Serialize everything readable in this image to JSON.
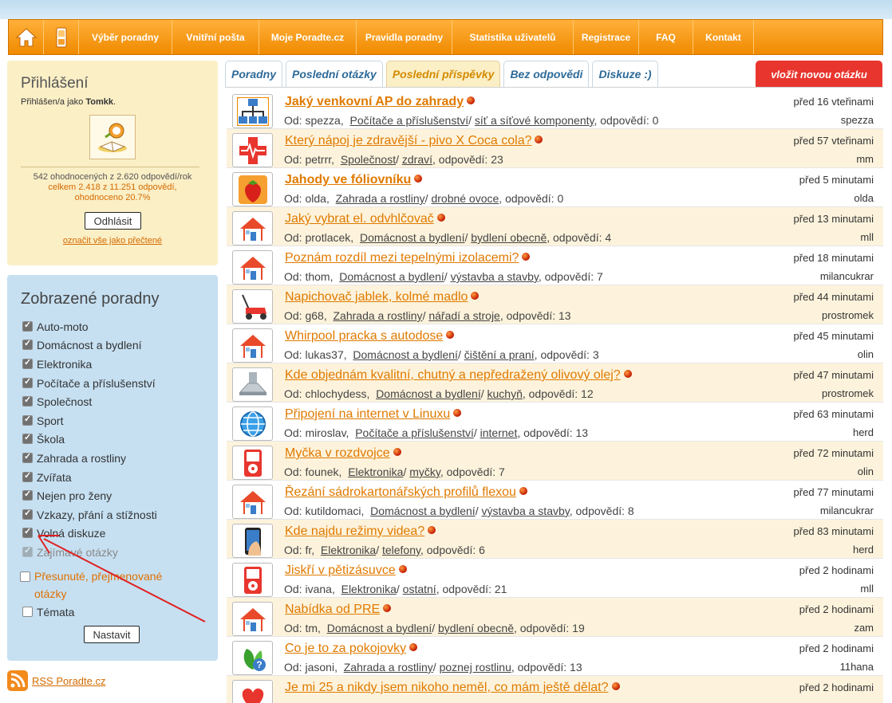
{
  "nav": {
    "items": [
      "Výběr poradny",
      "Vnitřní pošta",
      "Moje Poradte.cz",
      "Pravidla poradny",
      "Statistika uživatelů",
      "Registrace",
      "FAQ",
      "Kontakt"
    ]
  },
  "login": {
    "title": "Přihlášení",
    "logged_as_prefix": "Přihlášen/a jako ",
    "username": "Tomkk",
    "username_suffix": ".",
    "stats_line1": "542 ohodnocených z 2.620 odpovědí/rok",
    "stats_line2": "celkem 2.418 z 11.251 odpovědí,",
    "stats_line3": "ohodnoceno 20.7%",
    "logout_label": "Odhlásit",
    "mark_read_label": "označit vše jako přečtené"
  },
  "categories": {
    "title": "Zobrazené poradny",
    "items": [
      {
        "label": "Auto-moto",
        "checked": true
      },
      {
        "label": "Domácnost a bydlení",
        "checked": true
      },
      {
        "label": "Elektronika",
        "checked": true
      },
      {
        "label": "Počítače a příslušenství",
        "checked": true
      },
      {
        "label": "Společnost",
        "checked": true
      },
      {
        "label": "Sport",
        "checked": true
      },
      {
        "label": "Škola",
        "checked": true
      },
      {
        "label": "Zahrada a rostliny",
        "checked": true
      },
      {
        "label": "Zvířata",
        "checked": true
      },
      {
        "label": "Nejen pro ženy",
        "checked": true
      },
      {
        "label": "Vzkazy, přání a stížnosti",
        "checked": true
      },
      {
        "label": "Volná diskuze",
        "checked": true
      },
      {
        "label": "Zajímavé otázky",
        "checked": true,
        "disabled": true
      },
      {
        "label": "Přesunuté, přejmenované otázky",
        "checked": false,
        "orange": true
      },
      {
        "label": "Témata",
        "checked": false
      }
    ],
    "set_label": "Nastavit"
  },
  "rss": {
    "label": "RSS Poradte.cz"
  },
  "tabs": [
    {
      "label": "Poradny",
      "active": false
    },
    {
      "label": "Poslední otázky",
      "active": false
    },
    {
      "label": "Poslední příspěvky",
      "active": true
    },
    {
      "label": "Bez odpovědi",
      "active": false
    },
    {
      "label": "Diskuze :)",
      "active": false
    }
  ],
  "new_question_label": "vložit novou otázku",
  "questions": [
    {
      "title": "Jaký venkovní AP do zahrady",
      "bold": true,
      "author": "spezza",
      "cat": "Počítače a příslušenství",
      "sub": "síť a síťové komponenty",
      "answers": "0",
      "time": "před 16 vteřinami",
      "user": "spezza",
      "icon": "network-icon"
    },
    {
      "title": "Který nápoj je zdravější - pivo X Coca cola?",
      "bold": false,
      "author": "petrrr",
      "cat": "Společnost",
      "sub": "zdraví",
      "answers": "23",
      "time": "před 57 vteřinami",
      "user": "mm",
      "icon": "health-icon"
    },
    {
      "title": "Jahody ve fóliovníku",
      "bold": true,
      "author": "olda",
      "cat": "Zahrada a rostliny",
      "sub": "drobné ovoce",
      "answers": "0",
      "time": "před 5 minutami",
      "user": "olda",
      "icon": "strawberry-icon"
    },
    {
      "title": "Jaký vybrat el. odvhlčovač",
      "bold": false,
      "author": "protlacek",
      "cat": "Domácnost a bydlení",
      "sub": "bydlení obecně",
      "answers": "4",
      "time": "před 13 minutami",
      "user": "mll",
      "icon": "house-icon"
    },
    {
      "title": "Poznám rozdíl mezi tepelnými izolacemi?",
      "bold": false,
      "author": "thom",
      "cat": "Domácnost a bydlení",
      "sub": "výstavba a stavby",
      "answers": "7",
      "time": "před 18 minutami",
      "user": "milancukrar",
      "icon": "house-icon"
    },
    {
      "title": "Napichovač jablek, kolmé madlo",
      "bold": false,
      "author": "g68",
      "cat": "Zahrada a rostliny",
      "sub": "nářadí a stroje",
      "answers": "13",
      "time": "před 44 minutami",
      "user": "prostromek",
      "icon": "lawnmower-icon"
    },
    {
      "title": "Whirpool pracka s autodose",
      "bold": false,
      "author": "lukas37",
      "cat": "Domácnost a bydlení",
      "sub": "čištění a praní",
      "answers": "3",
      "time": "před 45 minutami",
      "user": "olin",
      "icon": "house-icon"
    },
    {
      "title": "Kde objednám kvalitní, chutný a nepředražený olivový olej?",
      "bold": false,
      "author": "chlochydess",
      "cat": "Domácnost a bydlení",
      "sub": "kuchyň",
      "answers": "12",
      "time": "před 47 minutami",
      "user": "prostromek",
      "icon": "kitchen-hood-icon"
    },
    {
      "title": "Připojení na internet v Linuxu",
      "bold": false,
      "author": "miroslav",
      "cat": "Počítače a příslušenství",
      "sub": "internet",
      "answers": "13",
      "time": "před 63 minutami",
      "user": "herd",
      "icon": "globe-icon"
    },
    {
      "title": "Myčka v rozdvojce",
      "bold": false,
      "author": "founek",
      "cat": "Elektronika",
      "sub": "myčky",
      "answers": "7",
      "time": "před 72 minutami",
      "user": "olin",
      "icon": "media-player-icon"
    },
    {
      "title": "Řezání sádrokartonářských profilů flexou",
      "bold": false,
      "author": "kutildomaci",
      "cat": "Domácnost a bydlení",
      "sub": "výstavba a stavby",
      "answers": "8",
      "time": "před 77 minutami",
      "user": "milancukrar",
      "icon": "house-icon"
    },
    {
      "title": "Kde najdu režimy videa?",
      "bold": false,
      "author": "fr",
      "cat": "Elektronika",
      "sub": "telefony",
      "answers": "6",
      "time": "před 83 minutami",
      "user": "herd",
      "icon": "phone-icon"
    },
    {
      "title": "Jiskří v pětizásuvce",
      "bold": false,
      "author": "ivana",
      "cat": "Elektronika",
      "sub": "ostatní",
      "answers": "21",
      "time": "před 2 hodinami",
      "user": "mll",
      "icon": "media-player-icon"
    },
    {
      "title": "Nabídka od PRE",
      "bold": false,
      "author": "tm",
      "cat": "Domácnost a bydlení",
      "sub": "bydlení obecně",
      "answers": "19",
      "time": "před 2 hodinami",
      "user": "zam",
      "icon": "house-icon"
    },
    {
      "title": "Co je to za pokojovky",
      "bold": false,
      "author": "jasoni",
      "cat": "Zahrada a rostliny",
      "sub": "poznej rostlinu",
      "answers": "13",
      "time": "před 2 hodinami",
      "user": "11hana",
      "icon": "plant-question-icon"
    },
    {
      "title": "Je mi 25 a nikdy jsem nikoho neměl, co mám ještě dělat?",
      "bold": false,
      "author": "",
      "cat": "",
      "sub": "",
      "answers": "",
      "time": "před 2 hodinami",
      "user": "",
      "icon": "heart-icon"
    }
  ],
  "labels": {
    "from": "Od: ",
    "answers": "odpovědí: "
  },
  "colors": {
    "accent": "#f08a00",
    "link": "#e07a00",
    "tab_text": "#2d6a98",
    "new_question": "#e8362e"
  }
}
